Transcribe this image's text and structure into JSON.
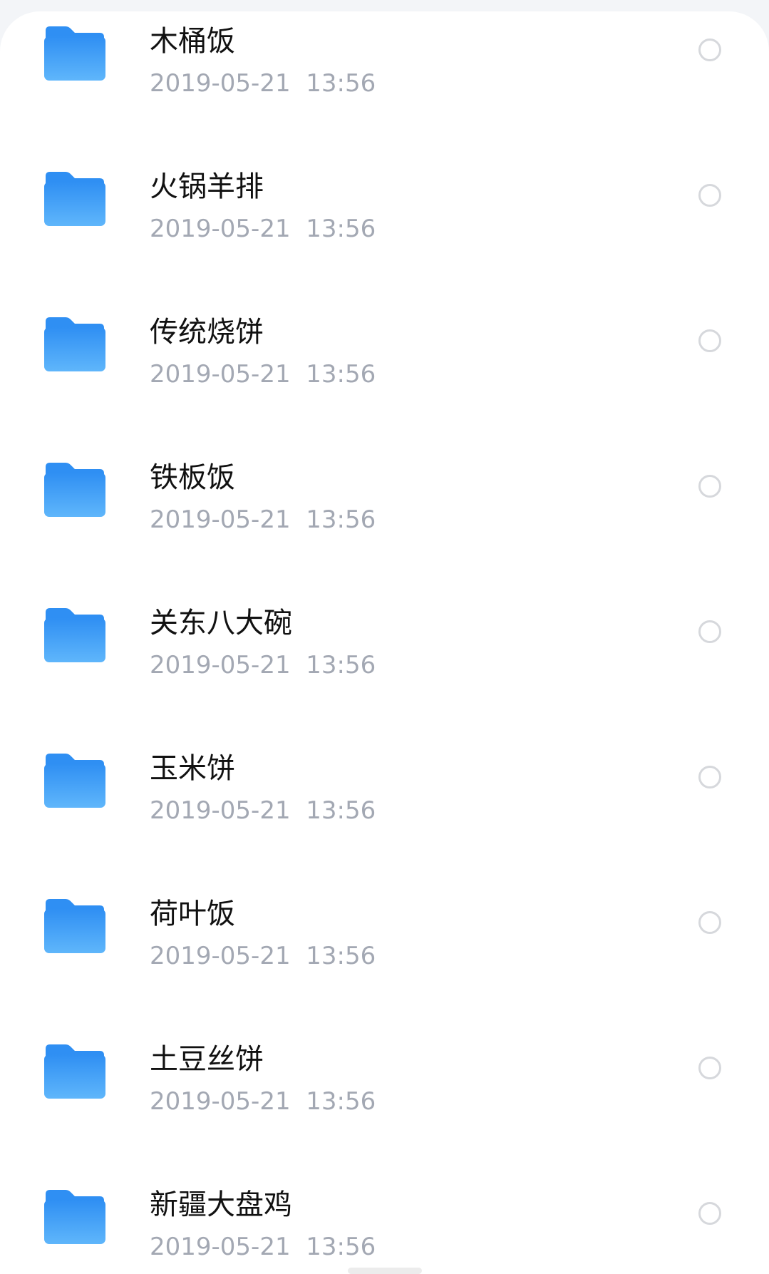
{
  "files": [
    {
      "name": "木桶饭",
      "date": "2019-05-21",
      "time": "13:56",
      "icon": "folder-icon",
      "selected": false
    },
    {
      "name": "火锅羊排",
      "date": "2019-05-21",
      "time": "13:56",
      "icon": "folder-icon",
      "selected": false
    },
    {
      "name": "传统烧饼",
      "date": "2019-05-21",
      "time": "13:56",
      "icon": "folder-icon",
      "selected": false
    },
    {
      "name": "铁板饭",
      "date": "2019-05-21",
      "time": "13:56",
      "icon": "folder-icon",
      "selected": false
    },
    {
      "name": "关东八大碗",
      "date": "2019-05-21",
      "time": "13:56",
      "icon": "folder-icon",
      "selected": false
    },
    {
      "name": "玉米饼",
      "date": "2019-05-21",
      "time": "13:56",
      "icon": "folder-icon",
      "selected": false
    },
    {
      "name": "荷叶饭",
      "date": "2019-05-21",
      "time": "13:56",
      "icon": "folder-icon",
      "selected": false
    },
    {
      "name": "土豆丝饼",
      "date": "2019-05-21",
      "time": "13:56",
      "icon": "folder-icon",
      "selected": false
    },
    {
      "name": "新疆大盘鸡",
      "date": "2019-05-21",
      "time": "13:56",
      "icon": "folder-icon",
      "selected": false
    }
  ],
  "colors": {
    "folder_top": "#2f8ff3",
    "folder_bottom": "#5fb6fb",
    "name_text": "#111111",
    "meta_text": "#a3a8b3",
    "radio_border": "#d6d8dc"
  }
}
